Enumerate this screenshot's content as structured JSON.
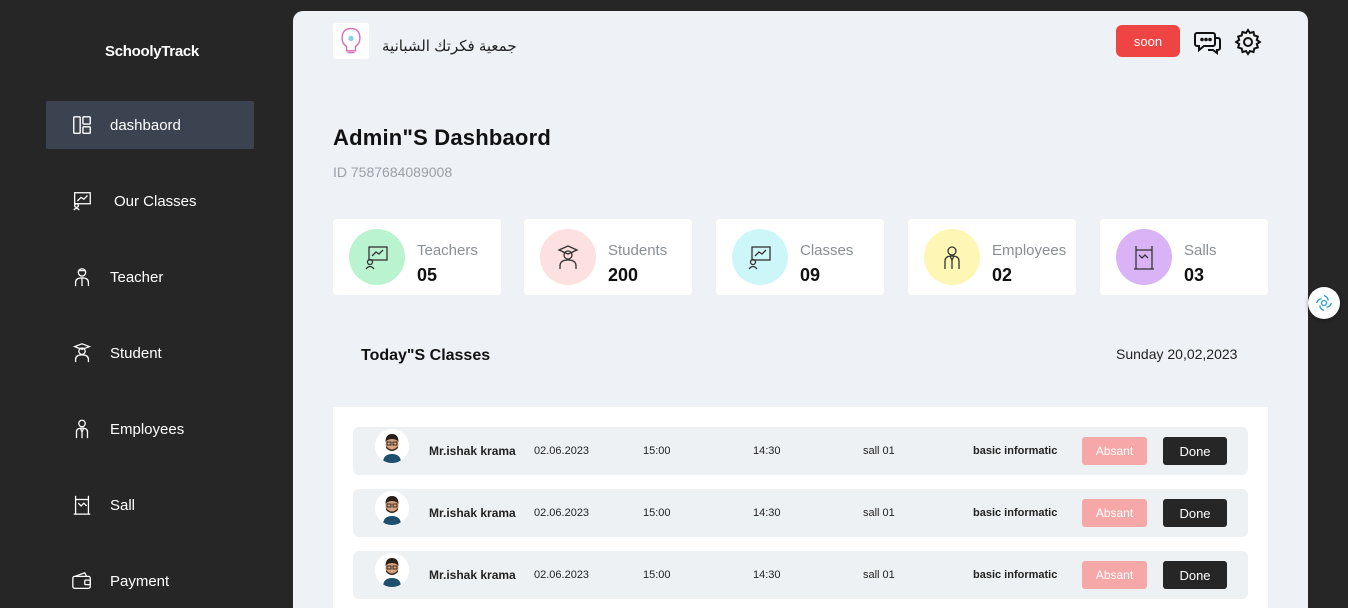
{
  "sidebar": {
    "brand": "SchoolyTrack",
    "items": [
      {
        "label": "dashbaord",
        "icon": "dashboard-icon",
        "active": true
      },
      {
        "label": "Our Classes",
        "icon": "classes-board-icon"
      },
      {
        "label": "Teacher",
        "icon": "teacher-icon"
      },
      {
        "label": "Student",
        "icon": "student-icon"
      },
      {
        "label": "Employees",
        "icon": "employee-icon"
      },
      {
        "label": "Sall",
        "icon": "hall-icon"
      },
      {
        "label": "Payment",
        "icon": "wallet-icon"
      }
    ]
  },
  "header": {
    "org_name": "جمعية فكرتك الشبانية",
    "soon_label": "soon",
    "chat_icon": "chat-icon",
    "settings_icon": "gear-icon"
  },
  "page": {
    "title": "Admin\"S Dashbaord",
    "id_text": "ID 7587684089008"
  },
  "stats": [
    {
      "label": "Teachers",
      "value": "05",
      "color": "#b9f3cf",
      "icon": "teacher-board-icon"
    },
    {
      "label": "Students",
      "value": "200",
      "color": "#fde0e0",
      "icon": "student-icon"
    },
    {
      "label": "Classes",
      "value": "09",
      "color": "#cdf6f8",
      "icon": "classes-board-icon"
    },
    {
      "label": "Employees",
      "value": "02",
      "color": "#fdf6b5",
      "icon": "employee-icon"
    },
    {
      "label": "Salls",
      "value": "03",
      "color": "#d9b3f5",
      "icon": "hall-icon"
    }
  ],
  "today": {
    "title": "Today\"S Classes",
    "date": "Sunday 20,02,2023",
    "rows": [
      {
        "name": "Mr.ishak krama",
        "date": "02.06.2023",
        "start": "15:00",
        "end": "14:30",
        "room": "sall 01",
        "subject": "basic informatic",
        "absent_label": "Absant",
        "done_label": "Done"
      },
      {
        "name": "Mr.ishak krama",
        "date": "02.06.2023",
        "start": "15:00",
        "end": "14:30",
        "room": "sall 01",
        "subject": "basic informatic",
        "absent_label": "Absant",
        "done_label": "Done"
      },
      {
        "name": "Mr.ishak krama",
        "date": "02.06.2023",
        "start": "15:00",
        "end": "14:30",
        "room": "sall 01",
        "subject": "basic informatic",
        "absent_label": "Absant",
        "done_label": "Done"
      }
    ]
  },
  "colors": {
    "sidebar_bg": "#262626",
    "active_item_bg": "#3b4250",
    "main_bg": "#eef1f6",
    "soon_red": "#ef4444",
    "absent_pink": "#f6a8a8",
    "done_dark": "#262626"
  }
}
